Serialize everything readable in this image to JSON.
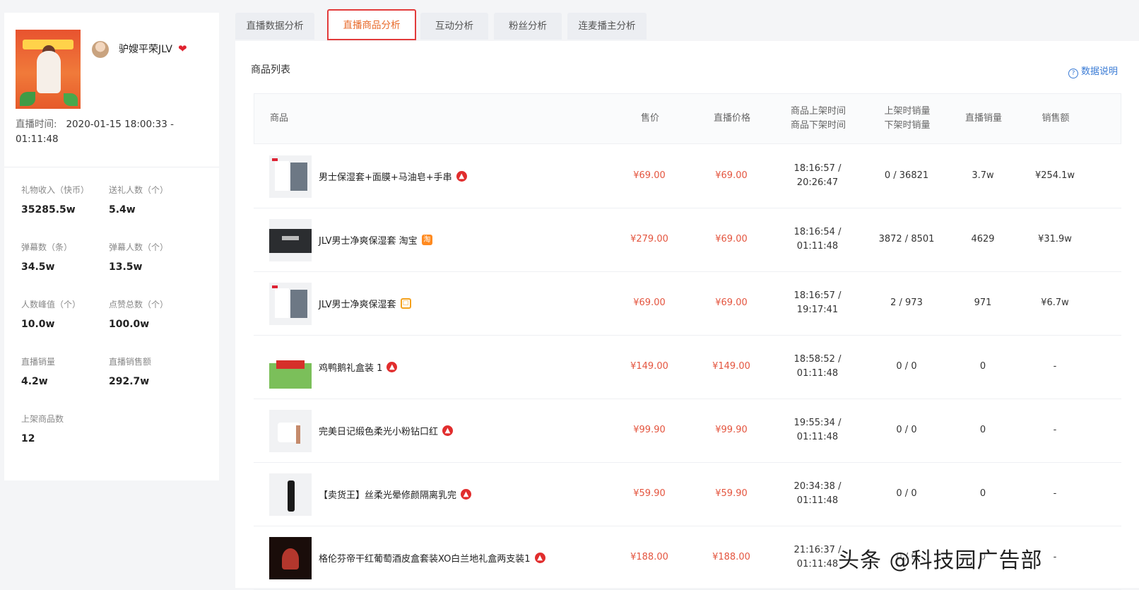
{
  "anchor": {
    "name": "驴嫂平荣JLV",
    "live_time_label": "直播时间:",
    "live_time_value": "2020-01-15 18:00:33 - 01:11:48"
  },
  "stats": [
    {
      "label": "礼物收入（快币）",
      "value": "35285.5w"
    },
    {
      "label": "送礼人数（个）",
      "value": "5.4w"
    },
    {
      "label": "弹幕数（条）",
      "value": "34.5w"
    },
    {
      "label": "弹幕人数（个）",
      "value": "13.5w"
    },
    {
      "label": "人数峰值（个）",
      "value": "10.0w"
    },
    {
      "label": "点赞总数（个）",
      "value": "100.0w"
    },
    {
      "label": "直播销量",
      "value": "4.2w"
    },
    {
      "label": "直播销售额",
      "value": "292.7w"
    },
    {
      "label": "上架商品数",
      "value": "12"
    }
  ],
  "tabs": [
    "直播数据分析",
    "直播商品分析",
    "互动分析",
    "粉丝分析",
    "连麦播主分析"
  ],
  "active_tab": "直播商品分析",
  "list_title": "商品列表",
  "data_help": "数据说明",
  "columns": {
    "product": "商品",
    "price": "售价",
    "live_price": "直播价格",
    "on_shelf": "商品上架时间",
    "off_shelf": "商品下架时间",
    "on_sales": "上架时销量",
    "off_sales": "下架时销量",
    "live_sales": "直播销量",
    "revenue": "销售额"
  },
  "products": [
    {
      "name": "男士保湿套+面膜+马油皂+手串",
      "badge": "fire",
      "price": "¥69.00",
      "live_price": "¥69.00",
      "on_time": "18:16:57 /",
      "off_time": "20:26:47",
      "sales_change": "0 / 36821",
      "live_sales": "3.7w",
      "revenue": "¥254.1w",
      "thumb": "box1"
    },
    {
      "name": "JLV男士净爽保湿套 淘宝",
      "badge": "taobao",
      "price": "¥279.00",
      "live_price": "¥69.00",
      "on_time": "18:16:54 /",
      "off_time": "01:11:48",
      "sales_change": "3872 / 8501",
      "live_sales": "4629",
      "revenue": "¥31.9w",
      "thumb": "dark"
    },
    {
      "name": "JLV男士净爽保湿套",
      "badge": "box",
      "price": "¥69.00",
      "live_price": "¥69.00",
      "on_time": "18:16:57 /",
      "off_time": "19:17:41",
      "sales_change": "2 / 973",
      "live_sales": "971",
      "revenue": "¥6.7w",
      "thumb": "box1"
    },
    {
      "name": "鸡鸭鹅礼盒装 1",
      "badge": "fire",
      "price": "¥149.00",
      "live_price": "¥149.00",
      "on_time": "18:58:52 /",
      "off_time": "01:11:48",
      "sales_change": "0 / 0",
      "live_sales": "0",
      "revenue": "-",
      "thumb": "game"
    },
    {
      "name": "完美日记缎色柔光小粉钻口红",
      "badge": "fire",
      "price": "¥99.90",
      "live_price": "¥99.90",
      "on_time": "19:55:34 /",
      "off_time": "01:11:48",
      "sales_change": "0 / 0",
      "live_sales": "0",
      "revenue": "-",
      "thumb": "lip"
    },
    {
      "name": "【卖货王】丝柔光晕修颜隔离乳完",
      "badge": "fire",
      "price": "¥59.90",
      "live_price": "¥59.90",
      "on_time": "20:34:38 /",
      "off_time": "01:11:48",
      "sales_change": "0 / 0",
      "live_sales": "0",
      "revenue": "-",
      "thumb": "tube"
    },
    {
      "name": "格伦芬帝干红葡萄酒皮盒套装XO白兰地礼盒两支装1",
      "badge": "fire",
      "price": "¥188.00",
      "live_price": "¥188.00",
      "on_time": "21:16:37 /",
      "off_time": "01:11:48",
      "sales_change": "0 / 0",
      "live_sales": "0",
      "revenue": "-",
      "thumb": "wine"
    }
  ],
  "watermark": "头条 @科技园广告部"
}
